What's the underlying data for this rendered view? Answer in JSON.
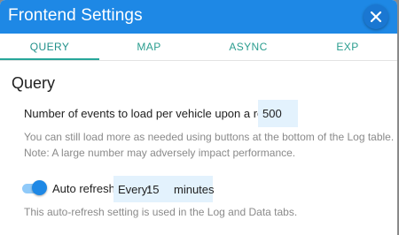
{
  "dialog": {
    "title": "Frontend Settings",
    "close_icon": "close-icon"
  },
  "tabs": [
    {
      "label": "QUERY",
      "active": true
    },
    {
      "label": "MAP",
      "active": false
    },
    {
      "label": "ASYNC",
      "active": false
    },
    {
      "label": "EXP",
      "active": false
    }
  ],
  "query": {
    "section_title": "Query",
    "events_label": "Number of events to load per vehicle upon a refresh:",
    "events_value": "500",
    "hint_line1": "You can still load more as needed using buttons at the bottom of the Log table.",
    "hint_line2": "Note: A large number may adversely impact performance.",
    "auto_refresh_label": "Auto refresh:",
    "auto_refresh_enabled": true,
    "every_prefix": "Every:",
    "every_value": "15",
    "every_unit": "minutes",
    "auto_refresh_hint": "This auto-refresh setting is used in the Log and Data tabs."
  },
  "colors": {
    "title_bar": "#1e88e5",
    "tab_text": "#2a9d8f",
    "tab_indicator": "#26a69a",
    "input_background": "#e3f2fd",
    "toggle_on": "#1e88e5"
  }
}
